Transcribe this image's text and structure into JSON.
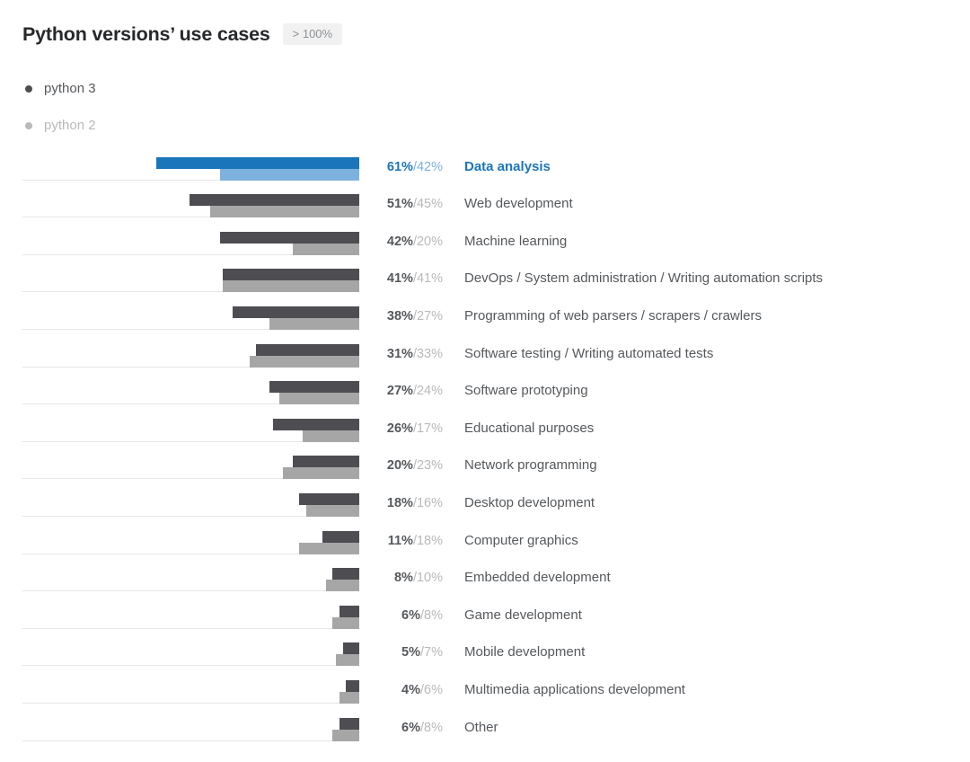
{
  "header": {
    "title": "Python versions’ use cases",
    "badge": "> 100%"
  },
  "legend": {
    "items": [
      {
        "label": "python 3",
        "color": "#4d4d52",
        "key": "py3"
      },
      {
        "label": "python 2",
        "color": "#b9b9b9",
        "key": "py2"
      }
    ]
  },
  "colors": {
    "highlight_dark": "#1a75bb",
    "highlight_light": "#7db1de",
    "bar_dark": "#4d4d52",
    "bar_light": "#a6a6a6",
    "track": "#e6e6e6",
    "text": "#55585c",
    "text_muted": "#b9b9b9",
    "badge_bg": "#f1f1f1"
  },
  "chart_data": {
    "type": "bar",
    "title": "Python versions’ use cases",
    "subtitle": "> 100%",
    "orientation": "horizontal",
    "bar_alignment": "right-aligned (bars extend leftward from a common right edge)",
    "xlabel": "",
    "ylabel": "",
    "xlim": [
      0,
      101
    ],
    "grid": false,
    "legend_position": "top-left",
    "value_unit": "%",
    "categories": [
      "Data analysis",
      "Web development",
      "Machine learning",
      "DevOps / System administration / Writing automation scripts",
      "Programming of web parsers / scrapers / crawlers",
      "Software testing / Writing automated tests",
      "Software prototyping",
      "Educational purposes",
      "Network programming",
      "Desktop development",
      "Computer graphics",
      "Embedded development",
      "Game development",
      "Mobile development",
      "Multimedia applications development",
      "Other"
    ],
    "series": [
      {
        "name": "python 3",
        "color": "#4d4d52",
        "values": [
          61,
          51,
          42,
          41,
          38,
          31,
          27,
          26,
          20,
          18,
          11,
          8,
          6,
          5,
          4,
          6
        ]
      },
      {
        "name": "python 2",
        "color": "#a6a6a6",
        "values": [
          42,
          45,
          20,
          41,
          27,
          33,
          24,
          17,
          23,
          16,
          18,
          10,
          8,
          7,
          6,
          8
        ]
      }
    ],
    "highlighted_index": 0
  },
  "rows": [
    {
      "category": "Data analysis",
      "py3": 61,
      "py2": 42,
      "py3_label": "61%",
      "py2_label": "42%",
      "highlight": true
    },
    {
      "category": "Web development",
      "py3": 51,
      "py2": 45,
      "py3_label": "51%",
      "py2_label": "45%",
      "highlight": false
    },
    {
      "category": "Machine learning",
      "py3": 42,
      "py2": 20,
      "py3_label": "42%",
      "py2_label": "20%",
      "highlight": false
    },
    {
      "category": "DevOps / System administration / Writing automation scripts",
      "py3": 41,
      "py2": 41,
      "py3_label": "41%",
      "py2_label": "41%",
      "highlight": false
    },
    {
      "category": "Programming of web parsers / scrapers / crawlers",
      "py3": 38,
      "py2": 27,
      "py3_label": "38%",
      "py2_label": "27%",
      "highlight": false
    },
    {
      "category": "Software testing / Writing automated tests",
      "py3": 31,
      "py2": 33,
      "py3_label": "31%",
      "py2_label": "33%",
      "highlight": false
    },
    {
      "category": "Software prototyping",
      "py3": 27,
      "py2": 24,
      "py3_label": "27%",
      "py2_label": "24%",
      "highlight": false
    },
    {
      "category": "Educational purposes",
      "py3": 26,
      "py2": 17,
      "py3_label": "26%",
      "py2_label": "17%",
      "highlight": false
    },
    {
      "category": "Network programming",
      "py3": 20,
      "py2": 23,
      "py3_label": "20%",
      "py2_label": "23%",
      "highlight": false
    },
    {
      "category": "Desktop development",
      "py3": 18,
      "py2": 16,
      "py3_label": "18%",
      "py2_label": "16%",
      "highlight": false
    },
    {
      "category": "Computer graphics",
      "py3": 11,
      "py2": 18,
      "py3_label": "11%",
      "py2_label": "18%",
      "highlight": false
    },
    {
      "category": "Embedded development",
      "py3": 8,
      "py2": 10,
      "py3_label": "8%",
      "py2_label": "10%",
      "highlight": false
    },
    {
      "category": "Game development",
      "py3": 6,
      "py2": 8,
      "py3_label": "6%",
      "py2_label": "8%",
      "highlight": false
    },
    {
      "category": "Mobile development",
      "py3": 5,
      "py2": 7,
      "py3_label": "5%",
      "py2_label": "7%",
      "highlight": false
    },
    {
      "category": "Multimedia applications development",
      "py3": 4,
      "py2": 6,
      "py3_label": "4%",
      "py2_label": "6%",
      "highlight": false
    },
    {
      "category": "Other",
      "py3": 6,
      "py2": 8,
      "py3_label": "6%",
      "py2_label": "8%",
      "highlight": false
    }
  ],
  "separator": "/"
}
